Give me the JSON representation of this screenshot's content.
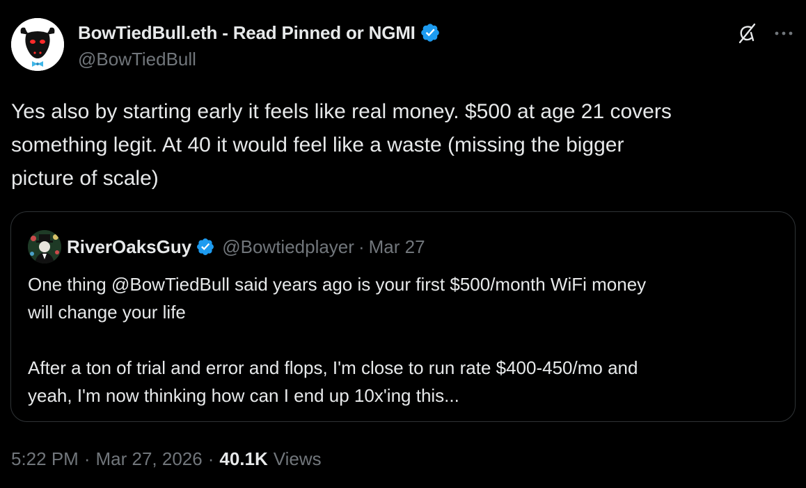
{
  "author": {
    "display_name": "BowTiedBull.eth - Read Pinned or NGMI",
    "handle": "@BowTiedBull",
    "verified_icon": "verified-badge-icon",
    "avatar": "bull-avatar"
  },
  "header_actions": {
    "grok_icon": "grok-icon",
    "more_icon": "more-options-icon"
  },
  "tweet": {
    "text": "Yes also by starting early it feels like real money. $500 at age 21 covers\nsomething legit. At 40 it would feel like a waste (missing the bigger\npicture of scale)"
  },
  "quote": {
    "display_name": "RiverOaksGuy",
    "handle": "@Bowtiedplayer",
    "separator": "·",
    "date": "Mar 27",
    "text": "One thing @BowTiedBull said years ago is your first $500/month WiFi money\nwill change your life\n\nAfter a ton of trial and error and flops, I'm close to run rate $400-450/mo and\nyeah, I'm now thinking how can I end up 10x'ing this..."
  },
  "meta": {
    "time": "5:22 PM",
    "separator": "·",
    "date": "Mar 27, 2026",
    "views_count": "40.1K",
    "views_label": "Views"
  },
  "colors": {
    "background": "#000000",
    "text_primary": "#e7e9ea",
    "text_secondary": "#71767b",
    "verified_blue": "#1d9bf0",
    "border": "#2f3336"
  }
}
